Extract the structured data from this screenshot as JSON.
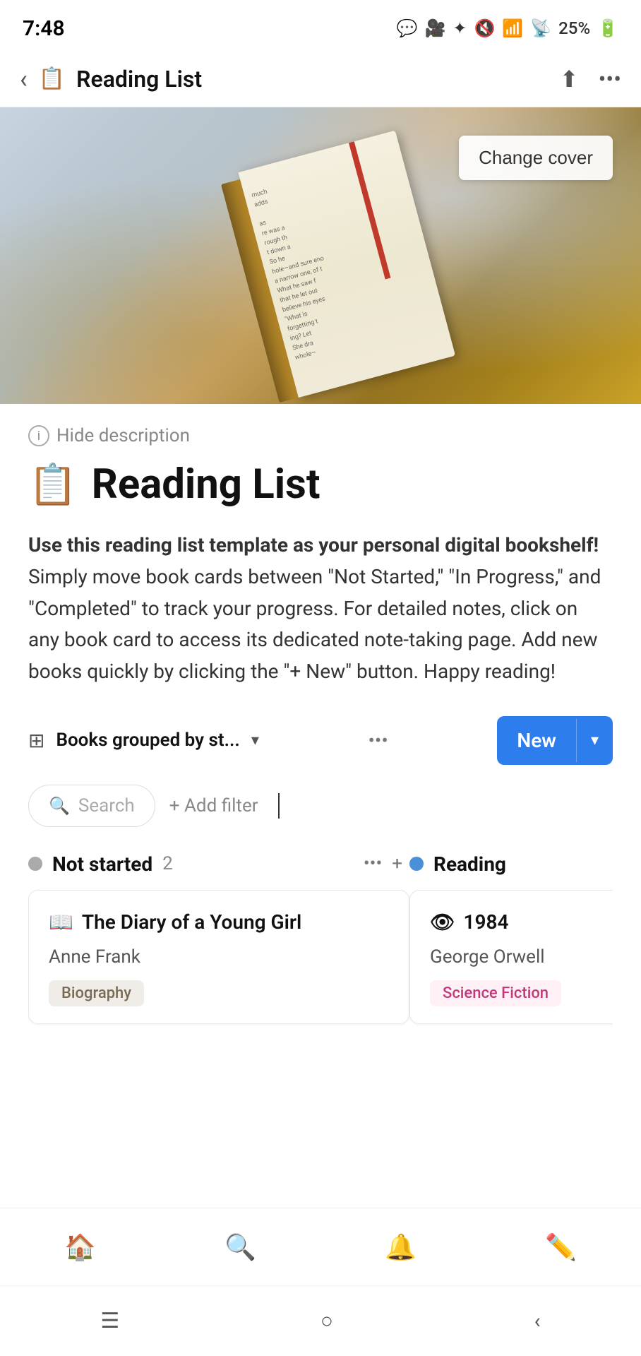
{
  "statusBar": {
    "time": "7:48",
    "batteryPercent": "25%",
    "icons": [
      "chat",
      "video",
      "bluetooth",
      "mute",
      "wifi",
      "signal"
    ]
  },
  "topNav": {
    "title": "Reading List",
    "backLabel": "Back",
    "shareIcon": "share",
    "moreIcon": "more"
  },
  "cover": {
    "changeCoverLabel": "Change cover"
  },
  "hideDescription": {
    "label": "Hide description"
  },
  "pageHeader": {
    "icon": "📋",
    "title": "Reading List"
  },
  "description": {
    "boldPart": "Use this reading list template as your personal digital bookshelf!",
    "normalPart": " Simply move book cards between \"Not Started,\" \"In Progress,\" and \"Completed\" to track your progress. For detailed notes, click on any book card to access its dedicated note-taking page. Add new books quickly by clicking the \"+ New\" button. Happy reading!"
  },
  "toolbar": {
    "dbIcon": "⊞",
    "viewLabel": "Books grouped by st...",
    "dotsLabel": "•••",
    "newLabel": "New",
    "chevronLabel": "▾"
  },
  "searchBar": {
    "searchPlaceholder": "Search",
    "addFilterLabel": "+ Add filter"
  },
  "columns": [
    {
      "id": "not-started",
      "statusLabel": "Not started",
      "count": "2",
      "dotColor": "gray",
      "cards": [
        {
          "emoji": "📖",
          "title": "The Diary of a Young Girl",
          "author": "Anne Frank",
          "tag": "Biography",
          "tagType": "biography"
        }
      ]
    },
    {
      "id": "reading",
      "statusLabel": "Reading",
      "count": "",
      "dotColor": "blue",
      "cards": [
        {
          "emoji": "👁",
          "title": "1984",
          "author": "George Orwell",
          "tag": "Science Fiction",
          "tagType": "scifi"
        }
      ]
    }
  ],
  "bottomNav": {
    "items": [
      {
        "icon": "🏠",
        "label": "home"
      },
      {
        "icon": "🔍",
        "label": "search"
      },
      {
        "icon": "🔔",
        "label": "notifications"
      },
      {
        "icon": "✏️",
        "label": "edit"
      }
    ]
  },
  "androidNav": {
    "menu": "☰",
    "home": "○",
    "back": "‹"
  }
}
